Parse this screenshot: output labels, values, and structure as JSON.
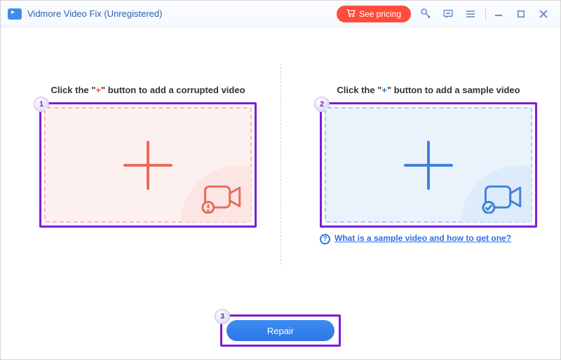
{
  "titlebar": {
    "app_title": "Vidmore Video Fix (Unregistered)",
    "see_pricing_label": "See pricing"
  },
  "panels": {
    "corrupted": {
      "heading_pre": "Click the \"",
      "heading_plus": "+",
      "heading_post": "\" button to add a corrupted video",
      "step": "1"
    },
    "sample": {
      "heading_pre": "Click the \"",
      "heading_plus": "+",
      "heading_post": "\" button to add a sample video",
      "step": "2",
      "help_text": "What is a sample video and how to get one?"
    }
  },
  "repair": {
    "step": "3",
    "label": "Repair"
  }
}
